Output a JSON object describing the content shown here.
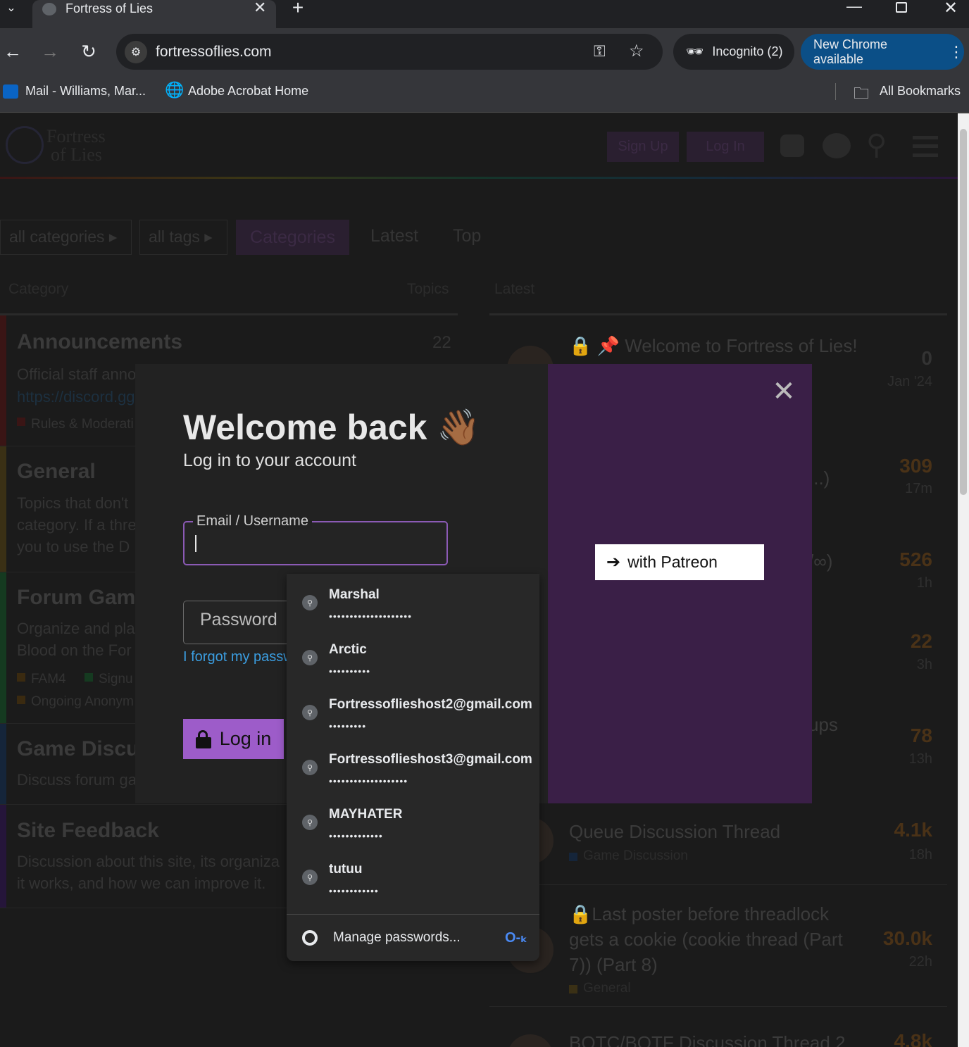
{
  "browser": {
    "tab_title": "Fortress of Lies",
    "url": "fortressoflies.com",
    "incognito_label": "Incognito (2)",
    "update_label": "New Chrome available",
    "bookmarks": [
      {
        "label": "Mail - Williams, Mar..."
      },
      {
        "label": "Adobe Acrobat Home"
      }
    ],
    "all_bookmarks": "All Bookmarks"
  },
  "site": {
    "logo_line1": "Fortress",
    "logo_line2": "of Lies",
    "signup": "Sign Up",
    "login": "Log In",
    "filters": {
      "all_categories": "all categories",
      "all_tags": "all tags",
      "tabs": [
        "Categories",
        "Latest",
        "Top"
      ]
    },
    "table_headers": {
      "category": "Category",
      "topics": "Topics",
      "latest": "Latest"
    },
    "categories": [
      {
        "title": "Announcements",
        "desc": "Official staff anno",
        "link": "https://discord.gg",
        "sub": "Rules & Moderati",
        "count": "22"
      },
      {
        "title": "General",
        "desc1": "Topics that don't",
        "desc2": "category. If a thre",
        "desc3": "you to use the D"
      },
      {
        "title": "Forum Gam",
        "desc1": "Organize and pla",
        "desc2": "Blood on the For",
        "sub1": "FAM4",
        "sub2": "Signu",
        "sub3": "Ongoing Anonym"
      },
      {
        "title": "Game Discu",
        "desc1": "Discuss forum ga"
      },
      {
        "title": "Site Feedback",
        "desc1": "Discussion about this site, its organiza",
        "desc2": "it works, and how we can improve it."
      }
    ],
    "latest": [
      {
        "title": "Welcome to Fortress of Lies!",
        "num": "0",
        "time": "Jan '24"
      },
      {
        "title": "...)",
        "num": "309",
        "time": "17m"
      },
      {
        "title": "/∞)",
        "num": "526",
        "time": "1h"
      },
      {
        "title": "",
        "num": "22",
        "time": "3h"
      },
      {
        "title": "ups",
        "num": "78",
        "time": "13h"
      },
      {
        "title": "Queue Discussion Thread",
        "sub": "Game Discussion",
        "num": "4.1k",
        "time": "18h"
      },
      {
        "title": "Last poster before threadlock gets a cookie (cookie thread (Part 7)) (Part 8)",
        "sub": "General",
        "num": "30.0k",
        "time": "22h"
      },
      {
        "title": "BOTC/BOTF Discussion Thread 2",
        "num": "4.8k",
        "time": ""
      }
    ]
  },
  "modal": {
    "title": "Welcome back",
    "subtitle": "Log in to your account",
    "email_label": "Email / Username",
    "password_label": "Password",
    "forgot": "I forgot my passw",
    "login_button": "Log in",
    "patreon_button": "with Patreon"
  },
  "autofill": {
    "items": [
      {
        "user": "Marshal",
        "pass": "••••••••••••••••••••"
      },
      {
        "user": "Arctic",
        "pass": "••••••••••"
      },
      {
        "user": "Fortressoflieshost2@gmail.com",
        "pass": "•••••••••"
      },
      {
        "user": "Fortressoflieshost3@gmail.com",
        "pass": "•••••••••••••••••••"
      },
      {
        "user": "MAYHATER",
        "pass": "•••••••••••••"
      },
      {
        "user": "tutuu",
        "pass": "••••••••••••"
      }
    ],
    "manage": "Manage passwords..."
  }
}
